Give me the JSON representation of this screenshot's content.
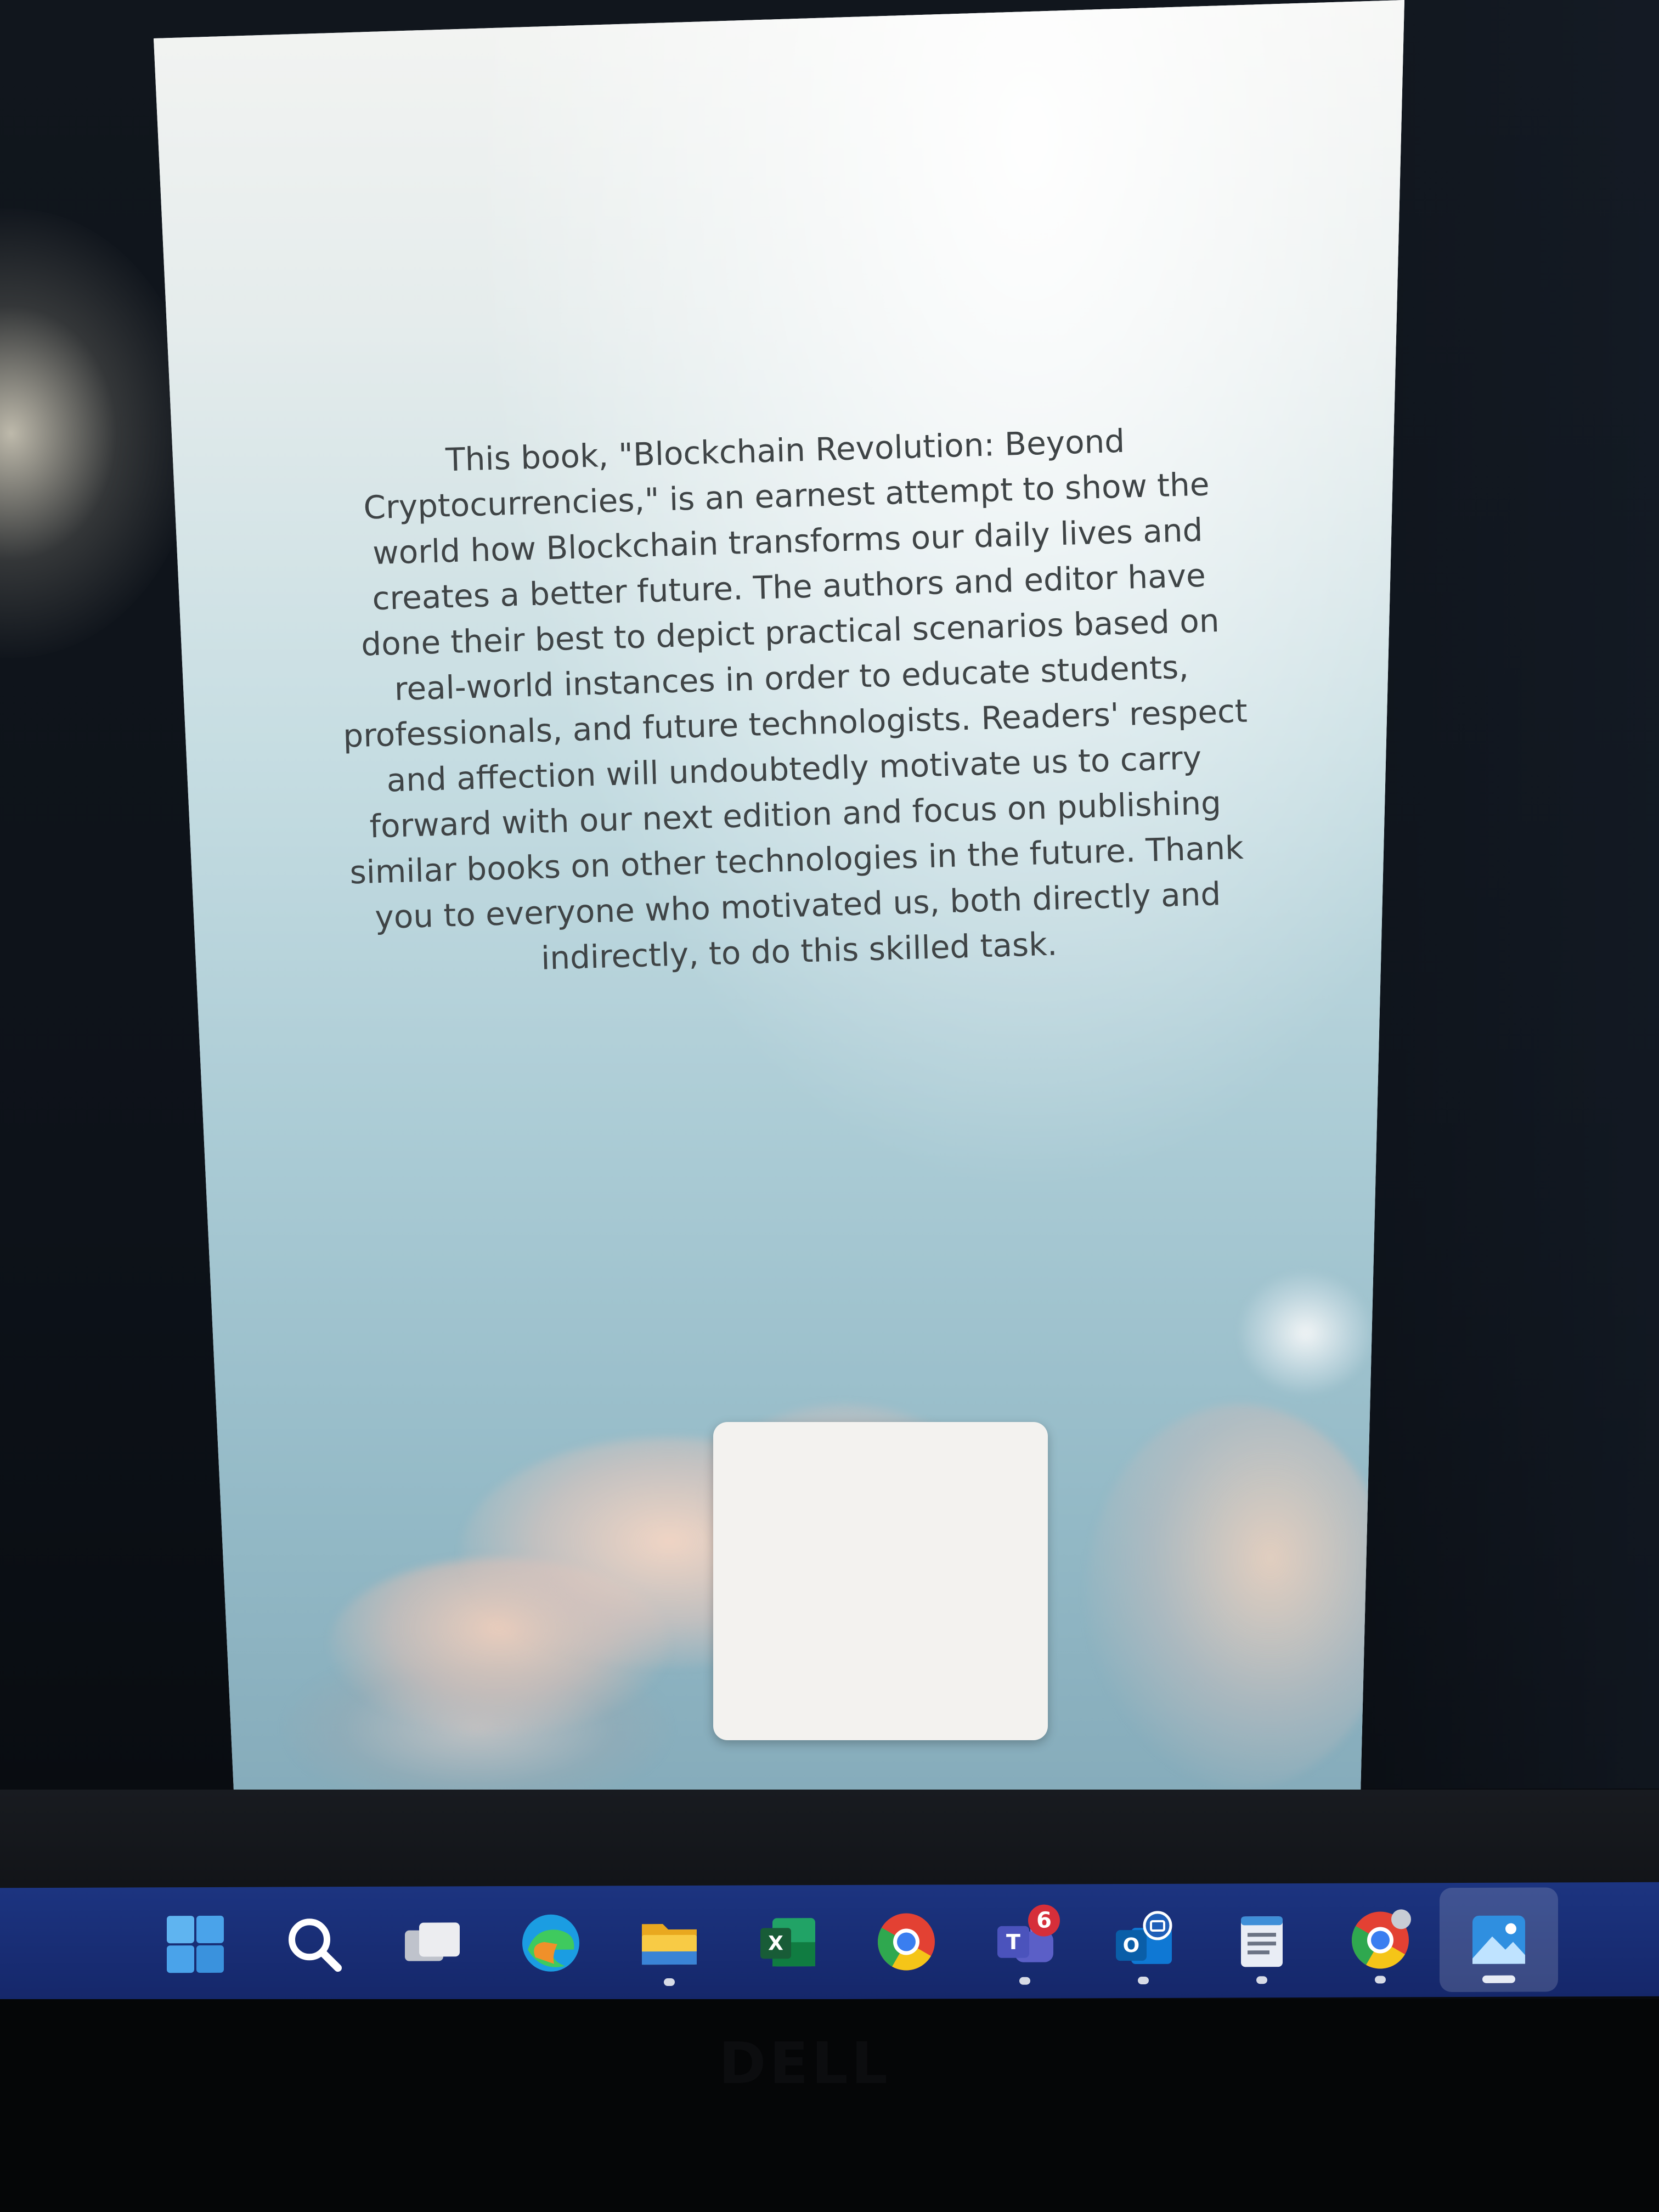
{
  "document": {
    "lines": [
      "This book, \"Blockchain Revolution: Beyond",
      "Cryptocurrencies,\" is an earnest attempt to show the",
      "world how Blockchain transforms our daily lives and",
      "creates a better future. The authors and editor have",
      "done their best to depict practical scenarios based on",
      "real-world instances in order to educate students,",
      "professionals, and future technologists. Readers' respect",
      "and affection will undoubtedly motivate us to carry",
      "forward with our next edition and focus on publishing",
      "similar books on other technologies in the future. Thank",
      "you to everyone who motivated us, both directly and",
      "indirectly, to do this skilled task."
    ]
  },
  "taskbar": {
    "items": [
      {
        "name": "start",
        "icon": "windows-start-icon",
        "running": false
      },
      {
        "name": "search",
        "icon": "search-icon",
        "running": false
      },
      {
        "name": "task-view",
        "icon": "task-view-icon",
        "running": false
      },
      {
        "name": "edge",
        "icon": "edge-icon",
        "running": false
      },
      {
        "name": "file-explorer",
        "icon": "folder-icon",
        "running": true
      },
      {
        "name": "excel",
        "icon": "excel-icon",
        "running": false
      },
      {
        "name": "chrome",
        "icon": "chrome-icon",
        "running": false
      },
      {
        "name": "teams",
        "icon": "teams-icon",
        "running": true,
        "badge": "6"
      },
      {
        "name": "outlook",
        "icon": "outlook-icon",
        "running": true
      },
      {
        "name": "notepad",
        "icon": "notepad-icon",
        "running": true
      },
      {
        "name": "chrome-profile",
        "icon": "chrome-profile-icon",
        "running": true
      },
      {
        "name": "photos",
        "icon": "photos-icon",
        "running": true,
        "active": true
      }
    ]
  },
  "colors": {
    "taskbar": "#1c3480",
    "page_text": "#3f4446",
    "badge": "#d62f3a"
  },
  "monitor_brand": "DELL"
}
